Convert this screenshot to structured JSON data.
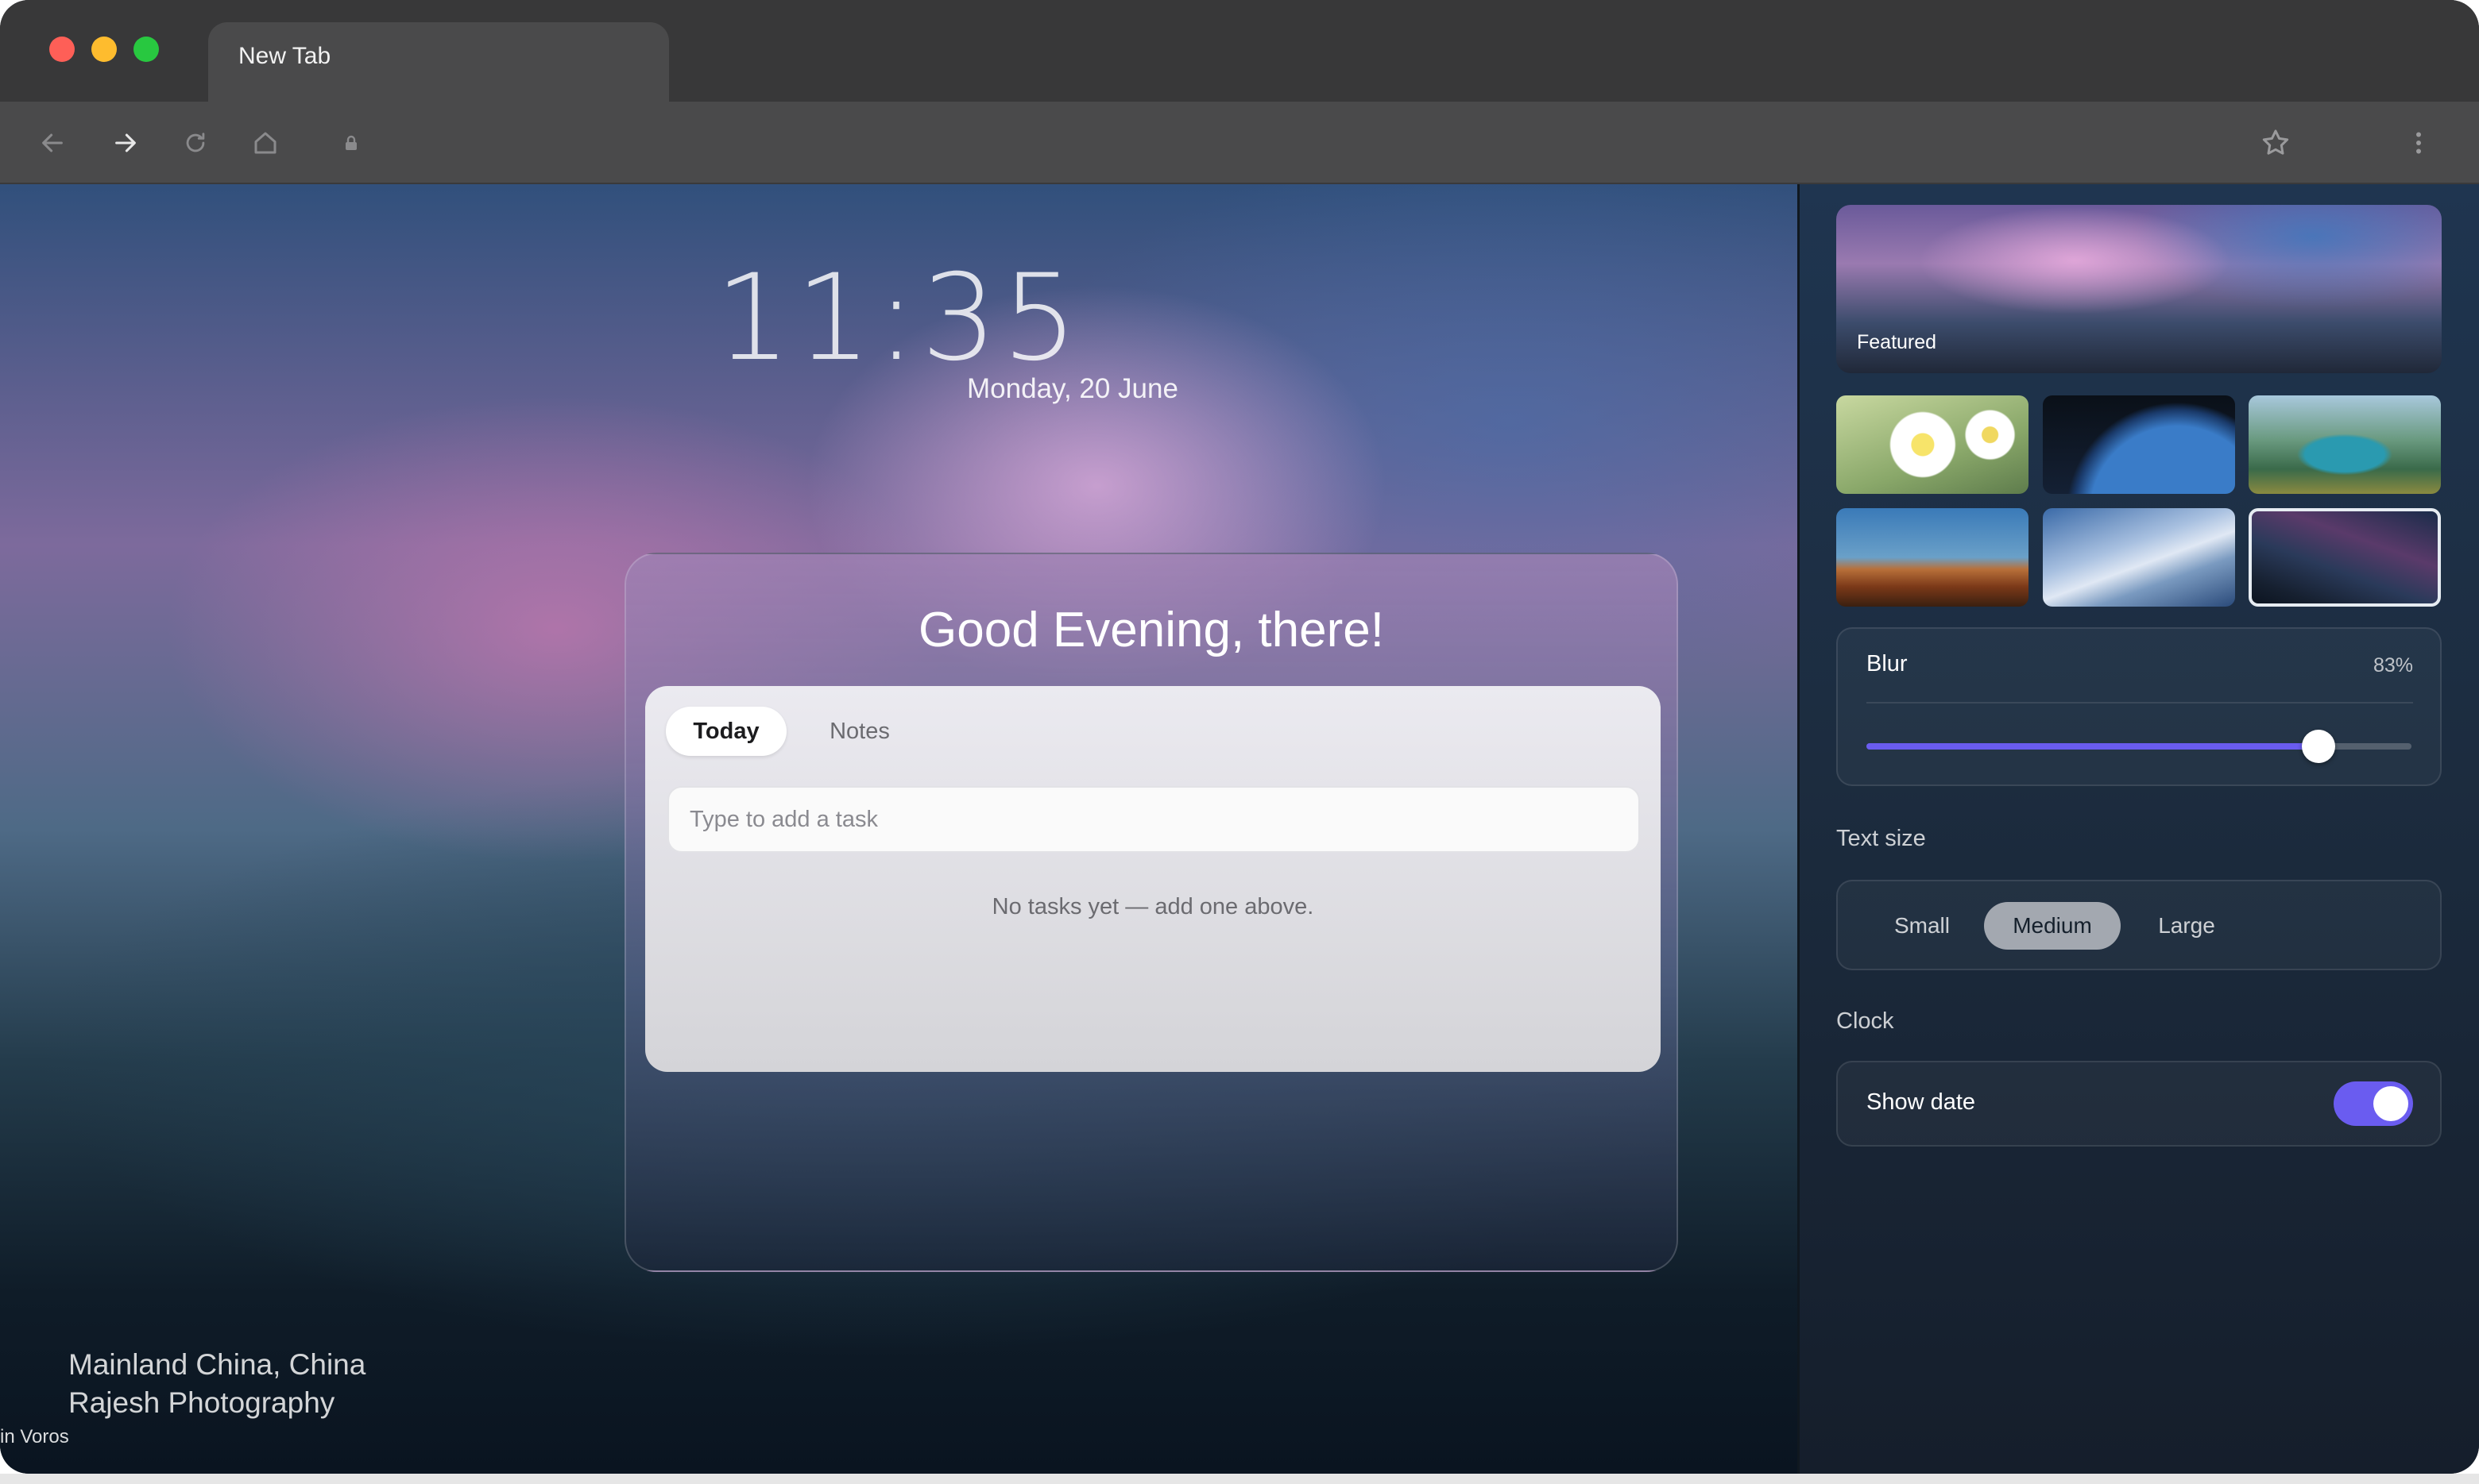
{
  "browser": {
    "tab_title": "New Tab",
    "nav_icons": [
      "back-arrow-icon",
      "forward-arrow-icon",
      "reload-icon",
      "home-icon",
      "lock-icon",
      "star-icon",
      "more-vertical-icon"
    ]
  },
  "newtab": {
    "time": "11:35",
    "date": "Monday, 20 June",
    "greeting": "Good Evening, there!",
    "tabs": [
      {
        "label": "Today",
        "selected": true
      },
      {
        "label": "Notes",
        "selected": false
      }
    ],
    "task_placeholder": "Type to add a task",
    "empty_message": "No tasks yet — add one above.",
    "credit": {
      "location": "Mainland China, China",
      "author": "Rajesh Photography",
      "source_fragment": "in Voros"
    }
  },
  "settings": {
    "featured_label": "Featured",
    "wallpapers": [
      {
        "name": "daisies",
        "selected": false
      },
      {
        "name": "earth",
        "selected": false
      },
      {
        "name": "lake",
        "selected": false
      },
      {
        "name": "desert-buttes",
        "selected": false
      },
      {
        "name": "snowy-peaks",
        "selected": false
      },
      {
        "name": "milky-way",
        "selected": true
      }
    ],
    "blur": {
      "label": "Blur",
      "value_text": "83%",
      "value": 0.83
    },
    "text_size": {
      "label": "Text size",
      "options": [
        "Small",
        "Medium",
        "Large"
      ],
      "selected": "Medium"
    },
    "clock": {
      "label": "Clock",
      "show_date_label": "Show date",
      "show_date": true
    }
  },
  "colors": {
    "accent": "#6a5cf0",
    "traffic_red": "#fe5f57",
    "traffic_yellow": "#febc2e",
    "traffic_green": "#28c840"
  }
}
